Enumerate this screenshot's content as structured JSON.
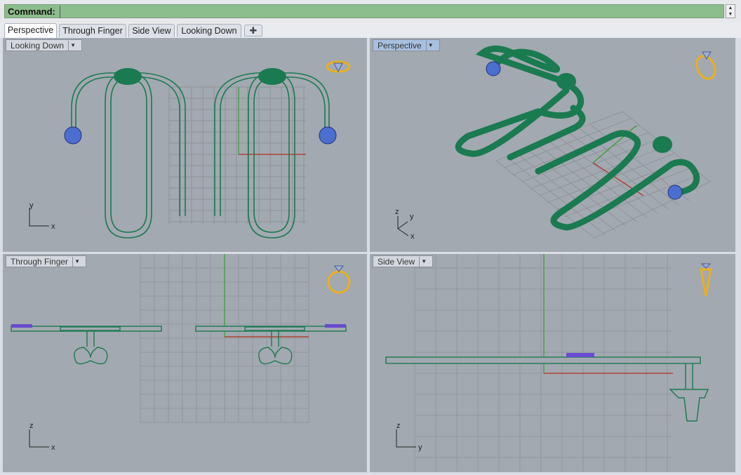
{
  "command": {
    "label": "Command:",
    "value": ""
  },
  "tabs": [
    {
      "label": "Perspective",
      "active": true
    },
    {
      "label": "Through Finger",
      "active": false
    },
    {
      "label": "Side View",
      "active": false
    },
    {
      "label": "Looking Down",
      "active": false
    }
  ],
  "add_tab_icon": "plus-icon",
  "viewports": [
    {
      "label": "Looking Down",
      "axes": [
        "y",
        "x"
      ]
    },
    {
      "label": "Perspective",
      "axes": [
        "z",
        "y",
        "x"
      ]
    },
    {
      "label": "Through Finger",
      "axes": [
        "z",
        "x"
      ]
    },
    {
      "label": "Side View",
      "axes": [
        "z",
        "y"
      ]
    }
  ],
  "colors": {
    "model": "#1a7a50",
    "grid": "#8d9298",
    "xaxis": "#b03020",
    "yaxis": "#30a030",
    "gem": "#4040c0",
    "ring_icon": "#e8b020"
  }
}
